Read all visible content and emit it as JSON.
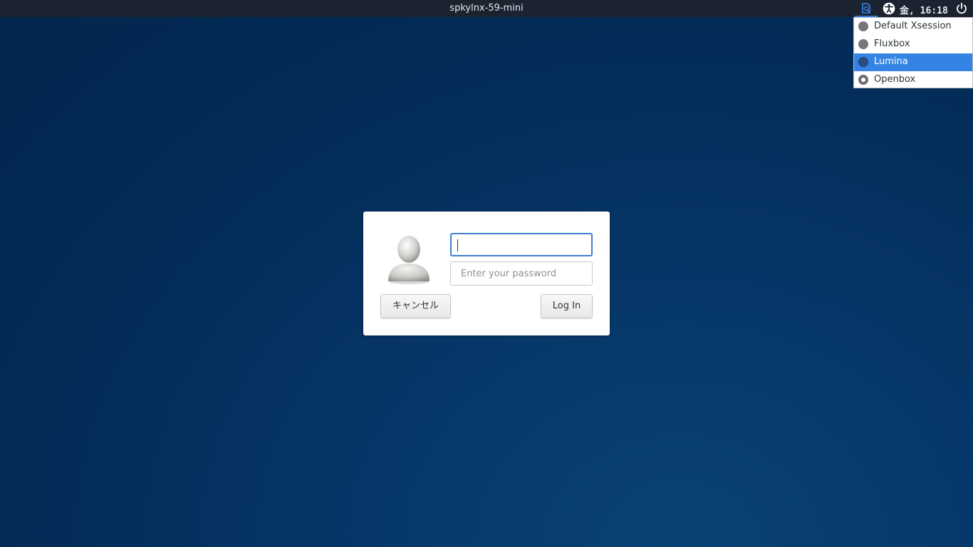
{
  "top_panel": {
    "hostname": "spkylnx-59-mini",
    "clock": "金, 16:18",
    "icons": [
      "session-icon",
      "accessibility-icon",
      "power-icon"
    ]
  },
  "session_menu": {
    "items": [
      {
        "label": "Default Xsession",
        "state": "normal"
      },
      {
        "label": "Fluxbox",
        "state": "normal"
      },
      {
        "label": "Lumina",
        "state": "highlighted"
      },
      {
        "label": "Openbox",
        "state": "active"
      }
    ]
  },
  "login": {
    "username_value": "",
    "password_placeholder": "Enter your password",
    "cancel_label": "キャンセル",
    "login_label": "Log In",
    "avatar": "user-avatar-icon"
  },
  "colors": {
    "background": "#032c58",
    "panel": "#1b2330",
    "accent": "#3584e4"
  }
}
